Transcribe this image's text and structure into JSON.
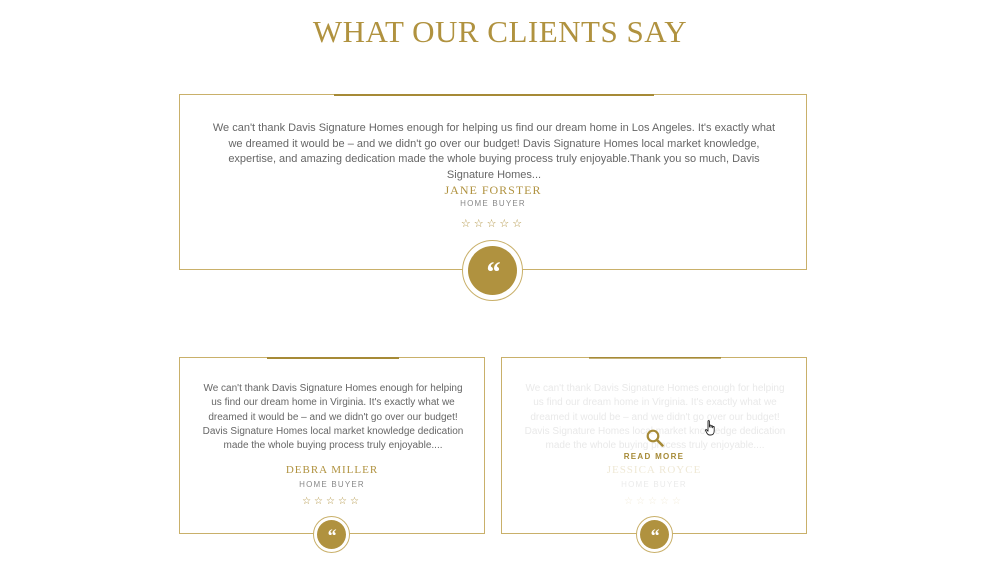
{
  "section": {
    "title": "WHAT OUR CLIENTS SAY"
  },
  "testimonials": [
    {
      "quote": "We can't thank Davis Signature Homes enough for helping us find our dream home in Los Angeles. It's exactly what we dreamed it would be – and we didn't go over our budget! Davis Signature Homes local market knowledge, expertise, and amazing dedication made the whole buying process truly enjoyable.Thank you so much, Davis Signature Homes...",
      "name": "JANE FORSTER",
      "role": "HOME BUYER",
      "stars": "☆☆☆☆☆",
      "quote_mark": "“"
    },
    {
      "quote": "We can't thank Davis Signature Homes enough for helping us find our dream home in Virginia. It's exactly what we dreamed it would be – and we didn't go over our budget! Davis Signature Homes local market knowledge dedication made the whole buying process truly enjoyable....",
      "name": "DEBRA MILLER",
      "role": "HOME BUYER",
      "stars": "☆☆☆☆☆",
      "quote_mark": "“"
    },
    {
      "quote": "We can't thank Davis Signature Homes enough for helping us find our dream home in Virginia. It's exactly what we dreamed it would be – and we didn't go over our budget! Davis Signature Homes local market knowledge dedication made the whole buying process truly enjoyable....",
      "name": "JESSICA ROYCE",
      "role": "HOME BUYER",
      "stars": "☆☆☆☆☆",
      "quote_mark": "“",
      "hover_action": "READ MORE"
    }
  ],
  "colors": {
    "accent": "#b0923f",
    "border": "#c9b06a",
    "text": "#666666"
  },
  "icons": {
    "hover_icon": "search-icon",
    "badge_icon": "quote-icon",
    "cursor": "hand-pointer-icon"
  }
}
